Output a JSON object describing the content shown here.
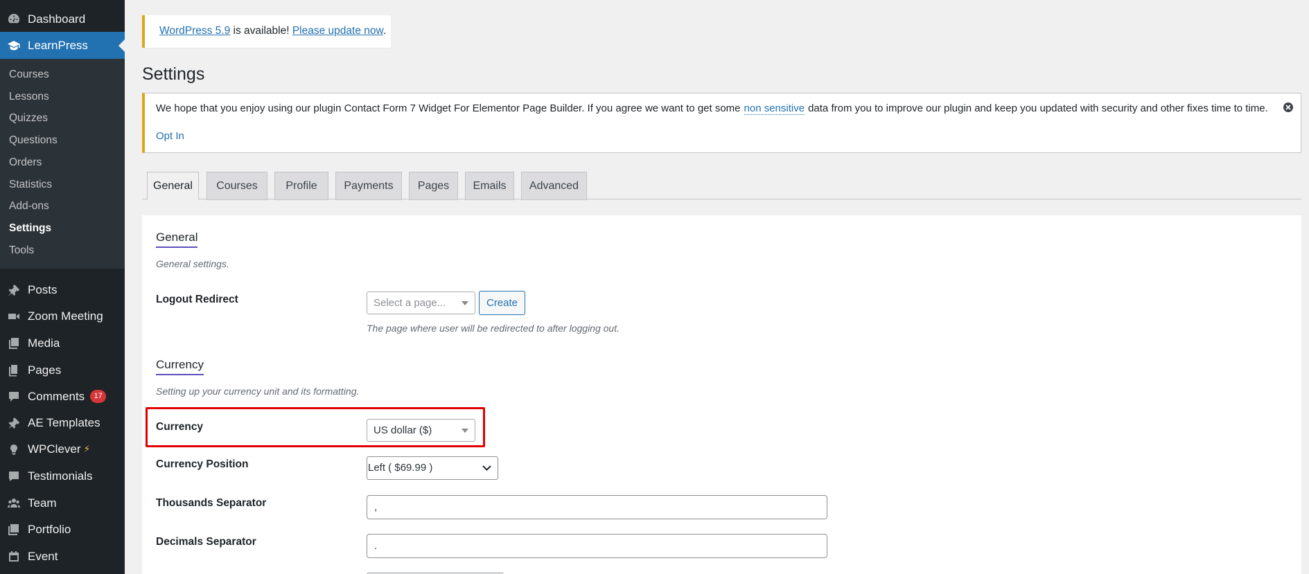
{
  "sidebar": {
    "top_items": [
      {
        "label": "Dashboard",
        "icon": "dashboard-icon"
      },
      {
        "label": "LearnPress",
        "icon": "graduation-cap-icon",
        "active": true
      }
    ],
    "submenu": [
      "Courses",
      "Lessons",
      "Quizzes",
      "Questions",
      "Orders",
      "Statistics",
      "Add-ons",
      "Settings",
      "Tools"
    ],
    "submenu_current": "Settings",
    "items": [
      {
        "label": "Posts",
        "icon": "pin-icon"
      },
      {
        "label": "Zoom Meeting",
        "icon": "video-icon"
      },
      {
        "label": "Media",
        "icon": "media-icon"
      },
      {
        "label": "Pages",
        "icon": "pages-icon"
      },
      {
        "label": "Comments",
        "icon": "comment-icon",
        "badge": "17"
      },
      {
        "label": "AE Templates",
        "icon": "pin-icon"
      },
      {
        "label": "WPClever",
        "icon": "bulb-icon"
      },
      {
        "label": "Testimonials",
        "icon": "testimonial-icon"
      },
      {
        "label": "Team",
        "icon": "team-icon"
      },
      {
        "label": "Portfolio",
        "icon": "portfolio-icon"
      },
      {
        "label": "Event",
        "icon": "event-icon"
      }
    ]
  },
  "update_notice": {
    "link": "WordPress 5.9",
    "text": " is available! ",
    "action": "Please update now",
    "end": "."
  },
  "page_title": "Settings",
  "plugin_notice": {
    "text_before": "We hope that you enjoy using our plugin Contact Form 7 Widget For Elementor Page Builder. If you agree we want to get some",
    "highlight": "non sensitive",
    "text_after": "data from you to improve our plugin and keep you updated with security and other fixes time to time.",
    "optin": "Opt In"
  },
  "tabs": [
    "General",
    "Courses",
    "Profile",
    "Payments",
    "Pages",
    "Emails",
    "Advanced"
  ],
  "active_tab": "General",
  "general": {
    "title": "General",
    "desc": "General settings.",
    "logout_label": "Logout Redirect",
    "logout_placeholder": "Select a page...",
    "create_button": "Create",
    "logout_help": "The page where user will be redirected to after logging out."
  },
  "currency": {
    "title": "Currency",
    "desc": "Setting up your currency unit and its formatting.",
    "currency_label": "Currency",
    "currency_value": "US dollar ($)",
    "position_label": "Currency Position",
    "position_value": "Left ( $69.99 )",
    "thousands_label": "Thousands Separator",
    "thousands_value": ",",
    "decimals_label": "Decimals Separator",
    "decimals_value": "."
  },
  "colors": {
    "accent": "#2271b1",
    "sidebar": "#1d2327",
    "highlight": "#e10000",
    "notice": "#dba617"
  }
}
